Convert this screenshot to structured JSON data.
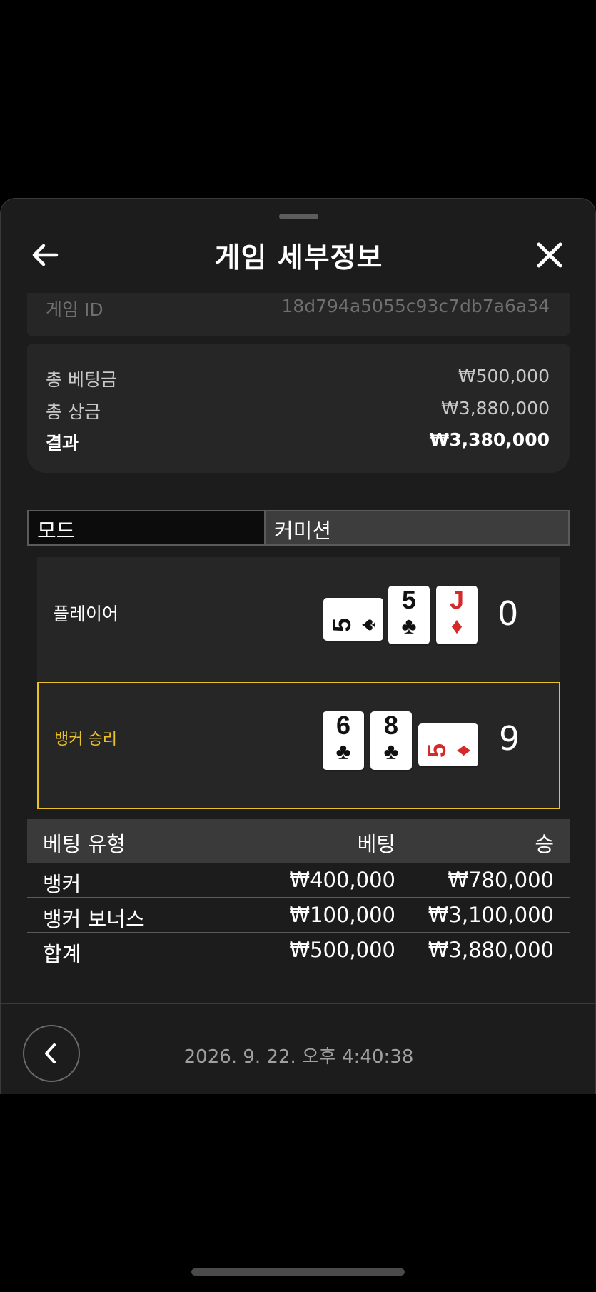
{
  "header": {
    "title": "게임 세부정보"
  },
  "game_id": {
    "label": "게임 ID",
    "value": "18d794a5055c93c7db7a6a34"
  },
  "summary": {
    "total_bet_label": "총 베팅금",
    "total_bet_value": "₩500,000",
    "total_prize_label": "총 상금",
    "total_prize_value": "₩3,880,000",
    "result_label": "결과",
    "result_value": "₩3,380,000"
  },
  "mode": {
    "tab_mode": "모드",
    "tab_commission": "커미션"
  },
  "player": {
    "label": "플레이어",
    "score": "0",
    "cards": [
      {
        "rank": "5",
        "suit": "♠",
        "color": "black",
        "orientation": "sideways"
      },
      {
        "rank": "5",
        "suit": "♣",
        "color": "black",
        "orientation": "upright"
      },
      {
        "rank": "J",
        "suit": "♦",
        "color": "red",
        "orientation": "upright"
      }
    ]
  },
  "banker": {
    "label": "뱅커 승리",
    "score": "9",
    "cards": [
      {
        "rank": "6",
        "suit": "♣",
        "color": "black",
        "orientation": "upright"
      },
      {
        "rank": "8",
        "suit": "♣",
        "color": "black",
        "orientation": "upright"
      },
      {
        "rank": "5",
        "suit": "♦",
        "color": "red",
        "orientation": "sideways"
      }
    ]
  },
  "bets": {
    "headers": [
      "베팅 유형",
      "베팅",
      "승"
    ],
    "rows": [
      [
        "뱅커",
        "₩400,000",
        "₩780,000"
      ],
      [
        "뱅커 보너스",
        "₩100,000",
        "₩3,100,000"
      ],
      [
        "합계",
        "₩500,000",
        "₩3,880,000"
      ]
    ]
  },
  "footer": {
    "timestamp": "2026. 9. 22. 오후 4:40:38"
  },
  "colors": {
    "background": "#1c1c1c",
    "card_panel": "#262626",
    "winner_accent": "#e9c229",
    "red_suit": "#d32a2a"
  }
}
